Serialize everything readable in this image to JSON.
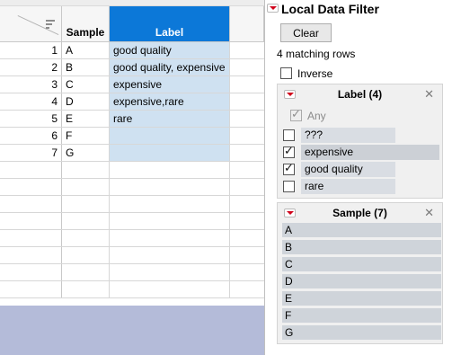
{
  "table": {
    "columns": [
      "Sample",
      "Label"
    ],
    "rows": [
      {
        "num": "1",
        "sample": "A",
        "label": "good quality"
      },
      {
        "num": "2",
        "sample": "B",
        "label": "good quality, expensive"
      },
      {
        "num": "3",
        "sample": "C",
        "label": "expensive"
      },
      {
        "num": "4",
        "sample": "D",
        "label": "expensive,rare"
      },
      {
        "num": "5",
        "sample": "E",
        "label": "rare"
      },
      {
        "num": "6",
        "sample": "F",
        "label": ""
      },
      {
        "num": "7",
        "sample": "G",
        "label": ""
      }
    ]
  },
  "filter": {
    "title": "Local Data Filter",
    "clear_label": "Clear",
    "match_text": "4 matching rows",
    "inverse_label": "Inverse",
    "label_group": {
      "title": "Label (4)",
      "any_label": "Any",
      "values": [
        {
          "text": "???",
          "checked": false
        },
        {
          "text": "expensive",
          "checked": true
        },
        {
          "text": "good quality",
          "checked": true
        },
        {
          "text": "rare",
          "checked": false
        }
      ]
    },
    "sample_group": {
      "title": "Sample (7)",
      "values": [
        "A",
        "B",
        "C",
        "D",
        "E",
        "F",
        "G"
      ]
    }
  },
  "colors": {
    "header_selected": "#0c78d8",
    "selected_cell": "#cfe1f1",
    "dropdown_triangle": "#d0021b"
  }
}
